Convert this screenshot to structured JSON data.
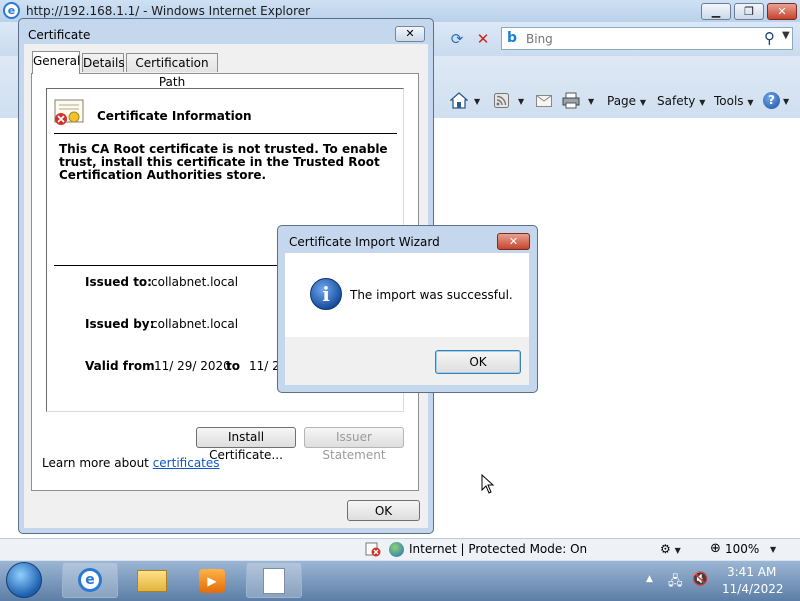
{
  "ie": {
    "title": "http://192.168.1.1/ - Windows Internet Explorer",
    "logo_letter": "e",
    "search_placeholder": "Bing",
    "toolbar": {
      "page_label": "Page",
      "safety_label": "Safety",
      "tools_label": "Tools"
    },
    "status": {
      "zone_text": "Internet | Protected Mode: On",
      "zoom_text": "100%"
    }
  },
  "cert_dialog": {
    "title": "Certificate",
    "tabs": [
      {
        "label": "General",
        "selected": true
      },
      {
        "label": "Details",
        "selected": false
      },
      {
        "label": "Certification Path",
        "selected": false
      }
    ],
    "heading": "Certificate Information",
    "trust_message": "This CA Root certificate is not trusted. To enable trust, install this certificate in the Trusted Root Certification Authorities store.",
    "issued_to_label": "Issued to:",
    "issued_to_value": "collabnet.local",
    "issued_by_label": "Issued by:",
    "issued_by_value": "collabnet.local",
    "valid_from_label": "Valid from",
    "valid_from_value": "11/ 29/ 2020",
    "valid_to_label": "to",
    "valid_to_value": "11/ 2",
    "install_button": "Install Certificate...",
    "issuer_statement_button": "Issuer Statement",
    "learn_more_prefix": "Learn more about",
    "learn_more_link": "certificates",
    "ok_button": "OK"
  },
  "wizard": {
    "title": "Certificate Import Wizard",
    "close_glyph": "✕",
    "message": "The import was successful.",
    "ok_button": "OK"
  },
  "taskbar": {
    "time": "3:41 AM",
    "date": "11/4/2022"
  }
}
